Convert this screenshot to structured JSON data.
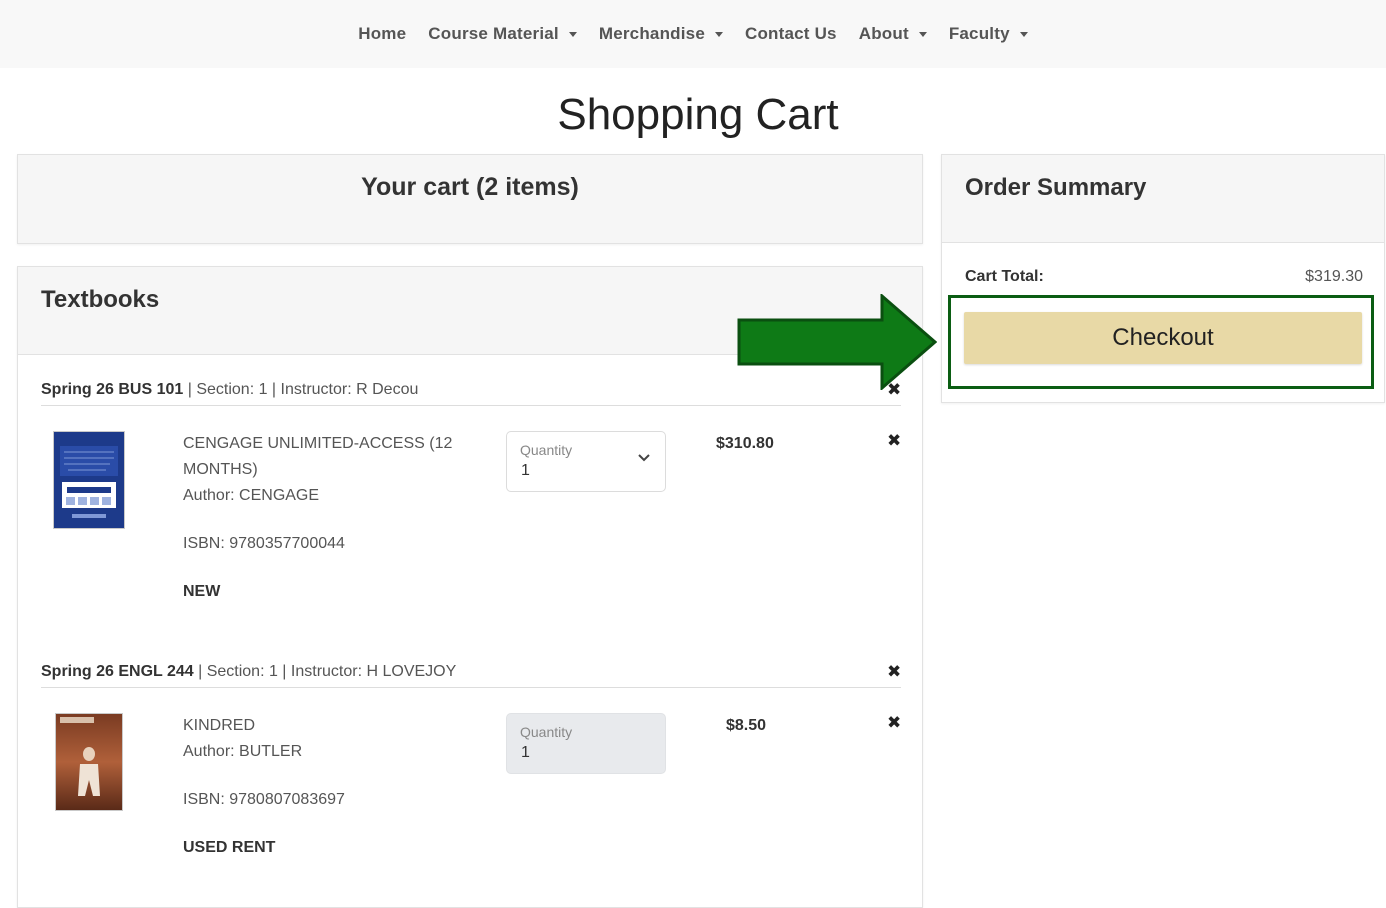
{
  "nav": {
    "items": [
      {
        "label": "Home",
        "dropdown": false
      },
      {
        "label": "Course Material",
        "dropdown": true
      },
      {
        "label": "Merchandise",
        "dropdown": true
      },
      {
        "label": "Contact Us",
        "dropdown": false
      },
      {
        "label": "About",
        "dropdown": true
      },
      {
        "label": "Faculty",
        "dropdown": true
      }
    ]
  },
  "page_title": "Shopping Cart",
  "cart_header": "Your cart (2 items)",
  "textbooks": {
    "title": "Textbooks",
    "sections": [
      {
        "course": "Spring 26 BUS 101",
        "details": " | Section: 1 | Instructor: R Decou",
        "book": {
          "title": "CENGAGE UNLIMITED-ACCESS (12 MONTHS)",
          "author": "Author: CENGAGE",
          "isbn": "ISBN: 9780357700044",
          "condition": "NEW",
          "quantity_label": "Quantity",
          "quantity": "1",
          "quantity_editable": true,
          "price": "$310.80"
        }
      },
      {
        "course": "Spring 26 ENGL 244",
        "details": " | Section: 1 | Instructor: H LOVEJOY",
        "book": {
          "title": "KINDRED",
          "author": "Author: BUTLER",
          "isbn": "ISBN: 9780807083697",
          "condition": "USED RENT",
          "quantity_label": "Quantity",
          "quantity": "1",
          "quantity_editable": false,
          "price": "$8.50"
        }
      }
    ]
  },
  "order_summary": {
    "title": "Order Summary",
    "total_label": "Cart Total:",
    "total_value": "$319.30",
    "checkout_label": "Checkout"
  },
  "colors": {
    "checkout_button": "#e8d9a6",
    "highlight": "#0b5d13",
    "arrow": "#0e7a16"
  },
  "icons": {
    "remove": "x-icon",
    "dropdown": "chevron-down-icon",
    "annotation": "arrow-right-icon"
  }
}
